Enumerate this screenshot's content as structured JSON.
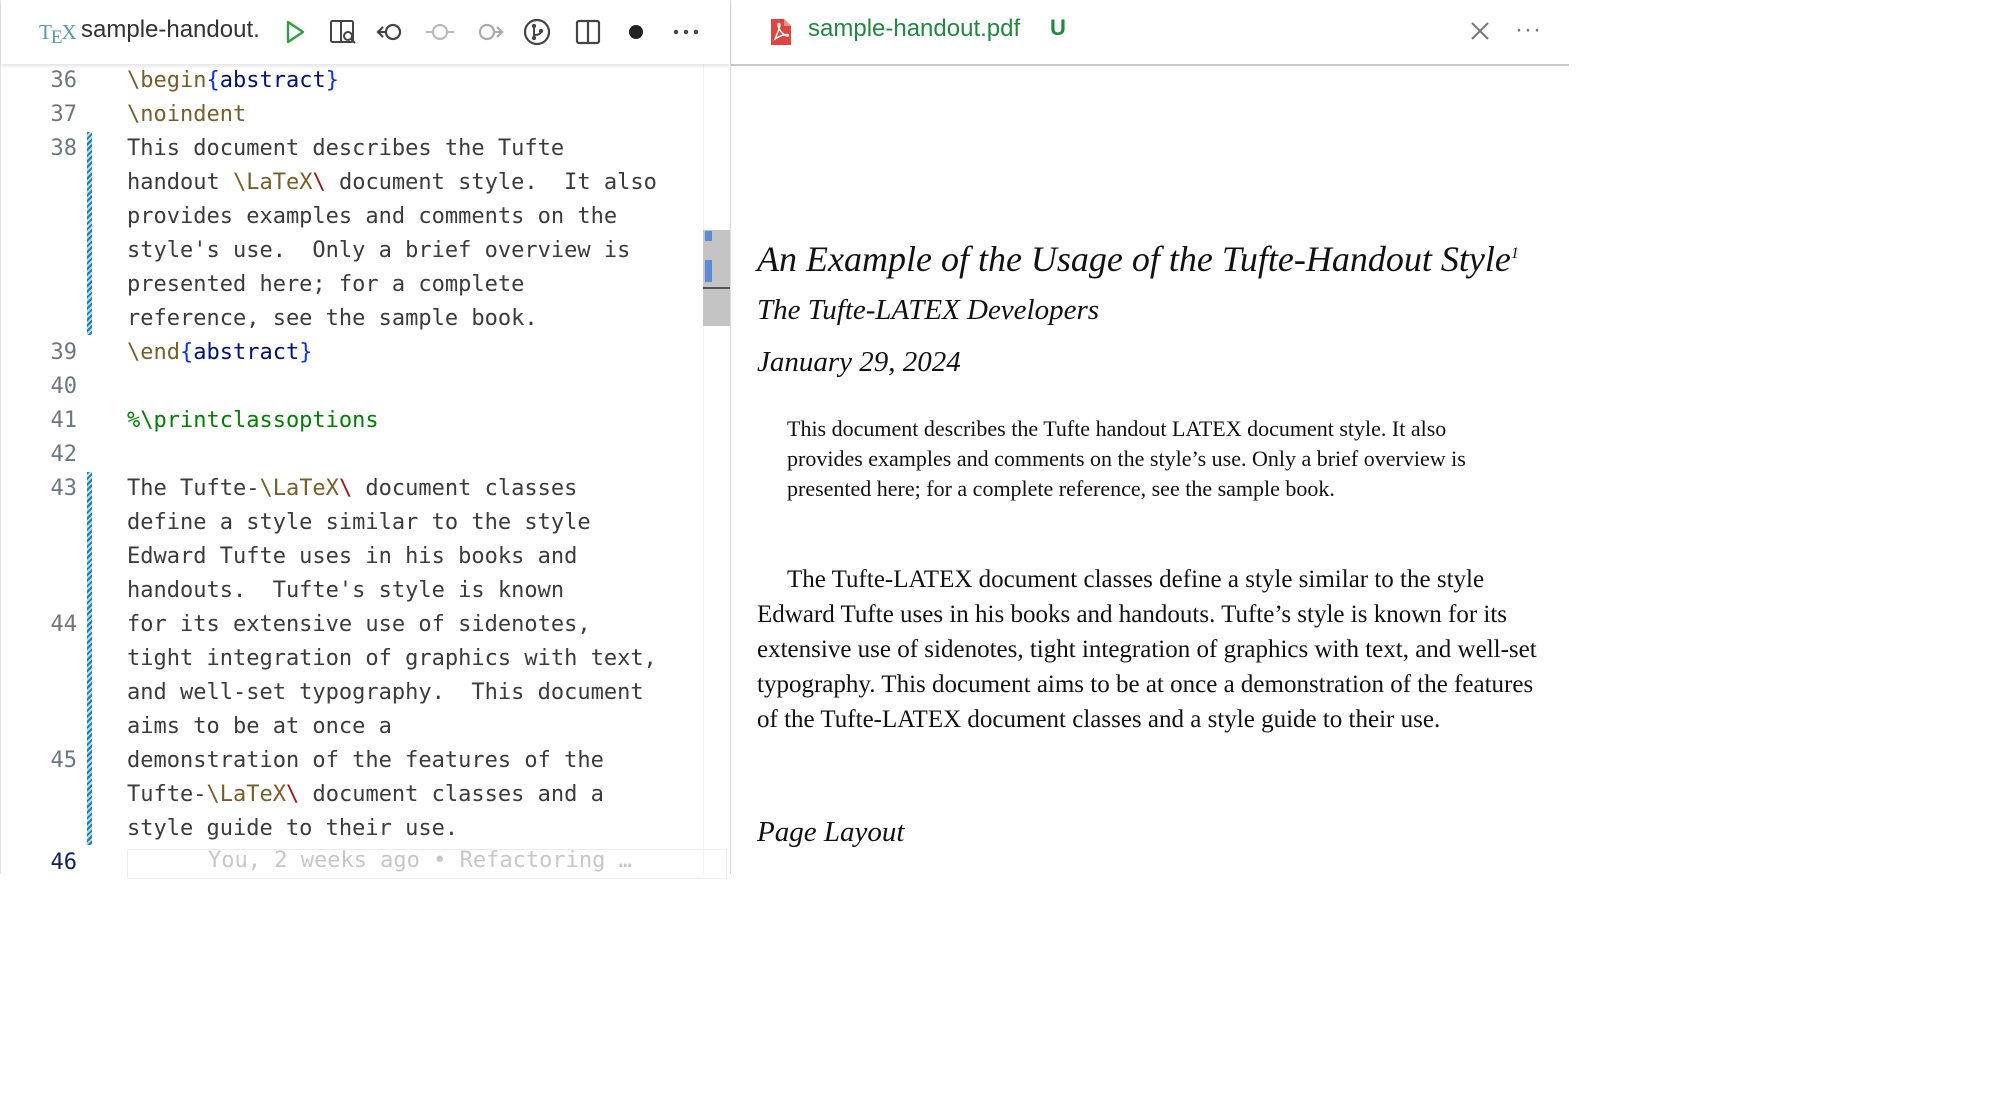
{
  "editor": {
    "tab_title": "sample-handout.",
    "file_type_label": "TEX",
    "toolbar": [
      "run-icon",
      "split-preview-icon",
      "back-icon",
      "history-circle-icon",
      "forward-icon",
      "git-graph-icon",
      "split-editor-icon",
      "unsaved-dot-icon",
      "more-icon"
    ],
    "lines": [
      {
        "num": "36",
        "html": "<span class=\"kw\">\\begin</span><span class=\"brace\">{</span><span class=\"env\">abstract</span><span class=\"brace\">}</span>"
      },
      {
        "num": "37",
        "html": "<span class=\"kw\">\\noindent</span>"
      },
      {
        "num": "38",
        "html": "This document describes the Tufte"
      },
      {
        "num": "",
        "html": "handout <span class=\"kw\">\\LaTeX</span><span class=\"cmd\">\\</span> document style.  It also"
      },
      {
        "num": "",
        "html": "provides examples and comments on the"
      },
      {
        "num": "",
        "html": "style's use.  Only a brief overview is"
      },
      {
        "num": "",
        "html": "presented here; for a complete"
      },
      {
        "num": "",
        "html": "reference, see the sample book."
      },
      {
        "num": "39",
        "html": "<span class=\"kw\">\\end</span><span class=\"brace\">{</span><span class=\"env\">abstract</span><span class=\"brace\">}</span>"
      },
      {
        "num": "40",
        "html": ""
      },
      {
        "num": "41",
        "html": "<span class=\"comment\">%\\printclassoptions</span>"
      },
      {
        "num": "42",
        "html": ""
      },
      {
        "num": "43",
        "html": "The Tufte-<span class=\"kw\">\\LaTeX</span><span class=\"cmd\">\\</span> document classes"
      },
      {
        "num": "",
        "html": "define a style similar to the style"
      },
      {
        "num": "",
        "html": "Edward Tufte uses in his books and"
      },
      {
        "num": "",
        "html": "handouts.  Tufte's style is known"
      },
      {
        "num": "44",
        "html": "for its extensive use of sidenotes,"
      },
      {
        "num": "",
        "html": "tight integration of graphics with text,"
      },
      {
        "num": "",
        "html": "and well-set typography.  This document"
      },
      {
        "num": "",
        "html": "aims to be at once a"
      },
      {
        "num": "45",
        "html": "demonstration of the features of the"
      },
      {
        "num": "",
        "html": "Tufte-<span class=\"kw\">\\LaTeX</span><span class=\"cmd\">\\</span> document classes and a"
      },
      {
        "num": "",
        "html": "style guide to their use."
      },
      {
        "num": "46",
        "html": ""
      }
    ],
    "blame": "You, 2 weeks ago • Refactoring …"
  },
  "viewer": {
    "tab_title": "sample-handout.pdf",
    "badge": "U",
    "title": "An Example of the Usage of the Tufte-Handout Style",
    "title_footnote": "1",
    "author": "The Tufte-LATEX Developers",
    "date": "January 29, 2024",
    "abstract": "This document describes the Tufte handout LATEX document style. It also provides examples and comments on the style’s use. Only a brief overview is presented here; for a complete reference, see the sample book.",
    "body": "The Tufte-LATEX document classes define a style similar to the style Edward Tufte uses in his books and handouts. Tufte’s style is known for its extensive use of sidenotes, tight integration of graphics with text, and well-set typography. This document aims to be at once a demonstration of the features of the Tufte-LATEX document classes and a style guide to their use.",
    "section": "Page Layout"
  },
  "colors": {
    "accent_blue": "#0431fa",
    "git_modified": "#1b81a8",
    "pdf_tab_green": "#1e8a3c",
    "pdf_icon_red": "#e0443e"
  }
}
